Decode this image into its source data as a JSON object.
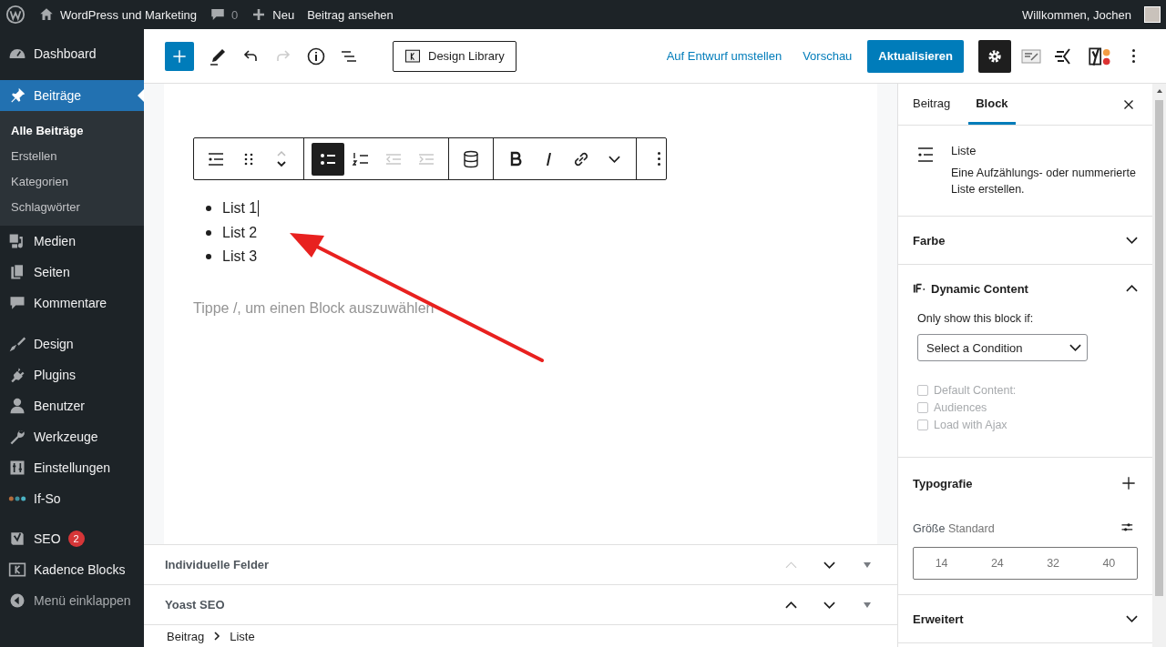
{
  "admin_bar": {
    "site_title": "WordPress und Marketing",
    "comments_count": "0",
    "new_label": "Neu",
    "view_label": "Beitrag ansehen",
    "greeting": "Willkommen, Jochen"
  },
  "sidebar": {
    "items": [
      {
        "label": "Dashboard",
        "selected": false
      },
      {
        "label": "Beiträge",
        "selected": true,
        "children": [
          {
            "label": "Alle Beiträge",
            "selected": true
          },
          {
            "label": "Erstellen",
            "selected": false
          },
          {
            "label": "Kategorien",
            "selected": false
          },
          {
            "label": "Schlagwörter",
            "selected": false
          }
        ]
      },
      {
        "label": "Medien",
        "selected": false
      },
      {
        "label": "Seiten",
        "selected": false
      },
      {
        "label": "Kommentare",
        "selected": false
      },
      {
        "label": "Design",
        "selected": false
      },
      {
        "label": "Plugins",
        "selected": false
      },
      {
        "label": "Benutzer",
        "selected": false
      },
      {
        "label": "Werkzeuge",
        "selected": false
      },
      {
        "label": "Einstellungen",
        "selected": false
      },
      {
        "label": "If-So",
        "selected": false
      },
      {
        "label": "SEO",
        "selected": false,
        "badge": "2"
      },
      {
        "label": "Kadence Blocks",
        "selected": false
      }
    ],
    "collapse_label": "Menü einklappen"
  },
  "header": {
    "redo_disabled": true,
    "design_library_label": "Design Library",
    "draft_link": "Auf Entwurf umstellen",
    "preview_link": "Vorschau",
    "update_button": "Aktualisieren",
    "settings_selected": true
  },
  "block_toolbar": {
    "list_buttons": [
      {
        "kind": "unordered",
        "selected": true
      },
      {
        "kind": "ordered",
        "selected": false
      }
    ],
    "indent_buttons": [
      {
        "kind": "outdent",
        "disabled": true
      },
      {
        "kind": "indent",
        "disabled": true
      }
    ]
  },
  "content": {
    "list_items": [
      "List 1",
      "List 2",
      "List 3"
    ],
    "placeholder": "Tippe /, um einen Block auszuwählen"
  },
  "meta_boxes": [
    {
      "title": "Individuelle Felder",
      "up_disabled": true
    },
    {
      "title": "Yoast SEO",
      "up_disabled": false
    }
  ],
  "breadcrumb": [
    "Beitrag",
    "Liste"
  ],
  "settings_panel": {
    "tabs": [
      {
        "label": "Beitrag",
        "selected": false
      },
      {
        "label": "Block",
        "selected": true
      }
    ],
    "block_card": {
      "title": "Liste",
      "description": "Eine Aufzählungs- oder nummerierte Liste erstellen."
    },
    "panels": [
      {
        "kind": "plain",
        "title": "Farbe",
        "expanded": false
      },
      {
        "kind": "dynamic",
        "title": "Dynamic Content",
        "expanded": true,
        "prompt": "Only show this block if:",
        "select_value": "Select a Condition",
        "checkboxes": [
          {
            "label": "Default Content:",
            "checked": false,
            "disabled": true
          },
          {
            "label": "Audiences",
            "checked": false,
            "disabled": true
          },
          {
            "label": "Load with Ajax",
            "checked": false,
            "disabled": true
          }
        ]
      },
      {
        "kind": "typography",
        "title": "Typografie",
        "size_label": "Größe",
        "size_value": "Standard",
        "sizes": [
          "14",
          "24",
          "32",
          "40"
        ]
      },
      {
        "kind": "plain",
        "title": "Erweitert",
        "expanded": false
      }
    ]
  }
}
